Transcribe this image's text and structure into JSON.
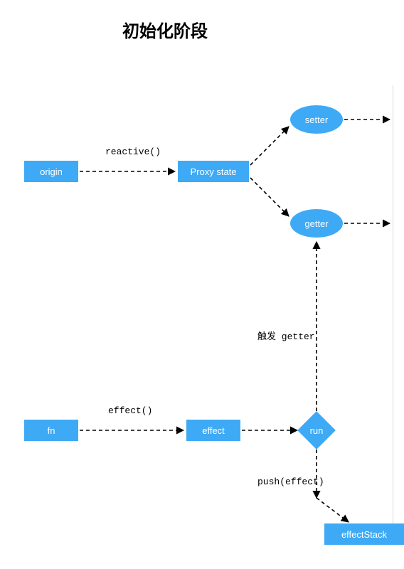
{
  "title": "初始化阶段",
  "colors": {
    "node_fill": "#3eaaf5",
    "node_text": "#ffffff"
  },
  "nodes": {
    "origin": {
      "label": "origin"
    },
    "proxy_state": {
      "label": "Proxy state"
    },
    "setter": {
      "label": "setter"
    },
    "getter": {
      "label": "getter"
    },
    "fn": {
      "label": "fn"
    },
    "effect": {
      "label": "effect"
    },
    "run": {
      "label": "run"
    },
    "effectStack": {
      "label": "effectStack"
    }
  },
  "edges": {
    "origin_to_proxy": {
      "label": "reactive()"
    },
    "fn_to_effect": {
      "label": "effect()"
    },
    "run_to_getter": {
      "label": "触发 getter"
    },
    "run_to_stack": {
      "label": "push(effect)"
    }
  },
  "chart_data": {
    "type": "flowchart",
    "nodes": [
      {
        "id": "origin",
        "shape": "rect",
        "label": "origin"
      },
      {
        "id": "proxy_state",
        "shape": "rect",
        "label": "Proxy state"
      },
      {
        "id": "setter",
        "shape": "ellipse",
        "label": "setter"
      },
      {
        "id": "getter",
        "shape": "ellipse",
        "label": "getter"
      },
      {
        "id": "fn",
        "shape": "rect",
        "label": "fn"
      },
      {
        "id": "effect",
        "shape": "rect",
        "label": "effect"
      },
      {
        "id": "run",
        "shape": "diamond",
        "label": "run"
      },
      {
        "id": "effectStack",
        "shape": "rect",
        "label": "effectStack"
      }
    ],
    "edges": [
      {
        "from": "origin",
        "to": "proxy_state",
        "label": "reactive()",
        "style": "dashed"
      },
      {
        "from": "proxy_state",
        "to": "setter",
        "label": "",
        "style": "dashed"
      },
      {
        "from": "proxy_state",
        "to": "getter",
        "label": "",
        "style": "dashed"
      },
      {
        "from": "setter",
        "to": "(external)",
        "label": "",
        "style": "dashed"
      },
      {
        "from": "getter",
        "to": "(external)",
        "label": "",
        "style": "dashed"
      },
      {
        "from": "fn",
        "to": "effect",
        "label": "effect()",
        "style": "dashed"
      },
      {
        "from": "effect",
        "to": "run",
        "label": "",
        "style": "dashed"
      },
      {
        "from": "run",
        "to": "getter",
        "label": "触发 getter",
        "style": "dashed"
      },
      {
        "from": "run",
        "to": "effectStack",
        "label": "push(effect)",
        "style": "dashed"
      }
    ]
  }
}
